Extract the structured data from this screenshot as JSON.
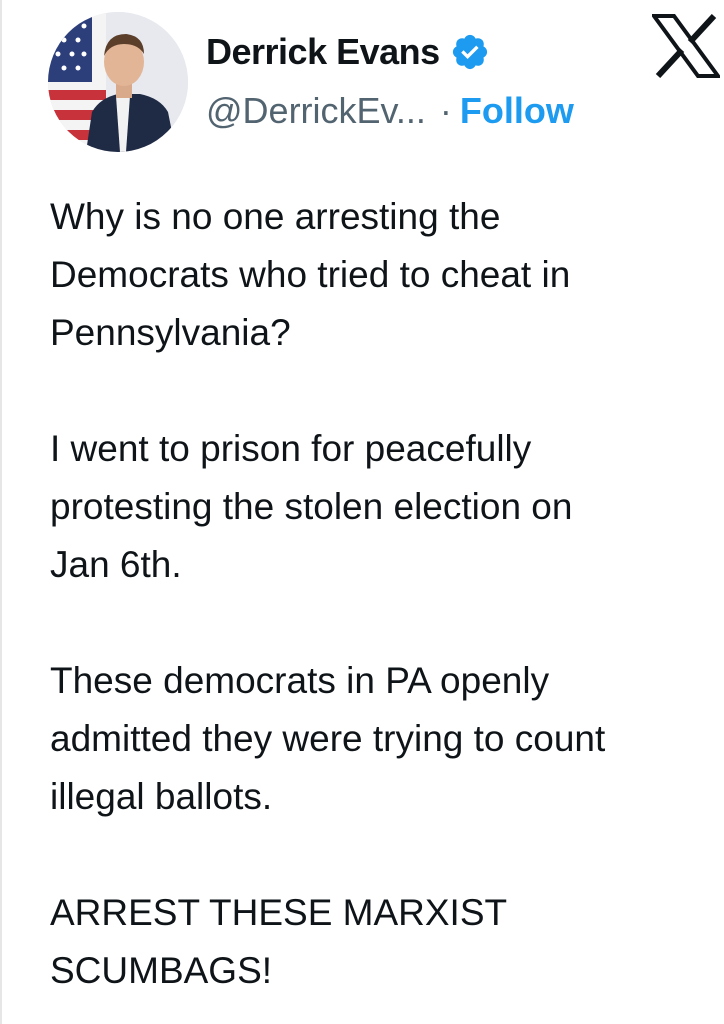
{
  "author": {
    "display_name": "Derrick Evans",
    "handle": "@DerrickEv...",
    "separator": "·",
    "follow_label": "Follow",
    "verified": true
  },
  "icons": {
    "verified": "verified-badge-icon",
    "platform": "x-logo-icon"
  },
  "colors": {
    "text": "#0f1419",
    "secondary": "#536471",
    "accent": "#1d9bf0"
  },
  "tweet": {
    "paragraphs": [
      "Why is no one arresting the\nDemocrats who tried to cheat in\nPennsylvania?",
      "I went to prison for peacefully\nprotesting the stolen election on\nJan 6th.",
      "These democrats in PA openly\nadmitted they were trying to count\nillegal ballots.",
      "ARREST THESE MARXIST\nSCUMBAGS!"
    ]
  }
}
